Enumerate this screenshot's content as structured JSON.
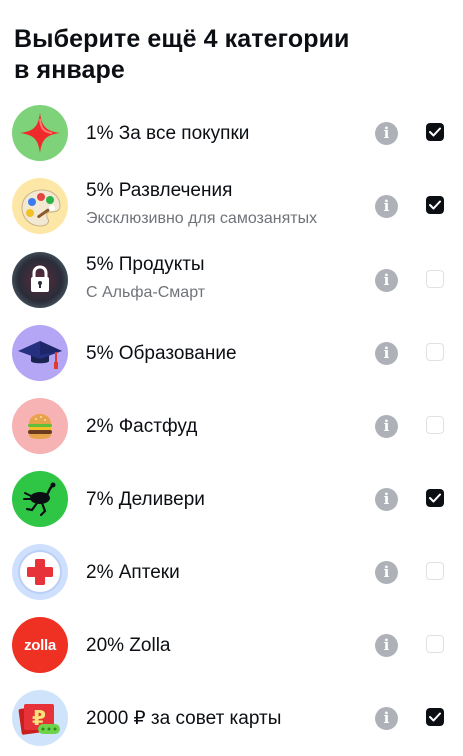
{
  "header": {
    "title_line1": "Выберите ещё 4 категории",
    "title_line2": "в январе"
  },
  "categories": [
    {
      "label": "1% За все покупки",
      "sub": "",
      "checked": true,
      "icon": "red-star-icon",
      "icon_bg": "#7ed27a"
    },
    {
      "label": "5% Развлечения",
      "sub": "Эксклюзивно для самозанятых",
      "checked": true,
      "icon": "palette-icon",
      "icon_bg": "#fde7a6"
    },
    {
      "label": "5% Продукты",
      "sub": "С Альфа-Смарт",
      "checked": false,
      "icon": "lock-icon",
      "icon_bg": "#1f2a33"
    },
    {
      "label": "5% Образование",
      "sub": "",
      "checked": false,
      "icon": "graduation-cap-icon",
      "icon_bg": "#b4a6f5"
    },
    {
      "label": "2% Фастфуд",
      "sub": "",
      "checked": false,
      "icon": "burger-icon",
      "icon_bg": "#f7b3b3"
    },
    {
      "label": "7% Деливери",
      "sub": "",
      "checked": true,
      "icon": "ostrich-icon",
      "icon_bg": "#2fc646"
    },
    {
      "label": "2% Аптеки",
      "sub": "",
      "checked": false,
      "icon": "medical-cross-icon",
      "icon_bg": "#cfe0ff"
    },
    {
      "label": "20% Zolla",
      "sub": "",
      "checked": false,
      "icon": "zolla-logo-icon",
      "icon_bg": "#ef3124"
    },
    {
      "label": "2000 ₽ за совет карты",
      "sub": "",
      "checked": true,
      "icon": "ruble-card-icon",
      "icon_bg": "#cfe4fb"
    }
  ],
  "zolla_logo_text": "zolla",
  "info_glyph": "i",
  "colors": {
    "text": "#0b0f14",
    "subtext": "#6f737a",
    "info_icon": "#aeb2b8",
    "checkbox_on": "#0b0f14",
    "checkbox_off_border": "#dfe1e5"
  }
}
